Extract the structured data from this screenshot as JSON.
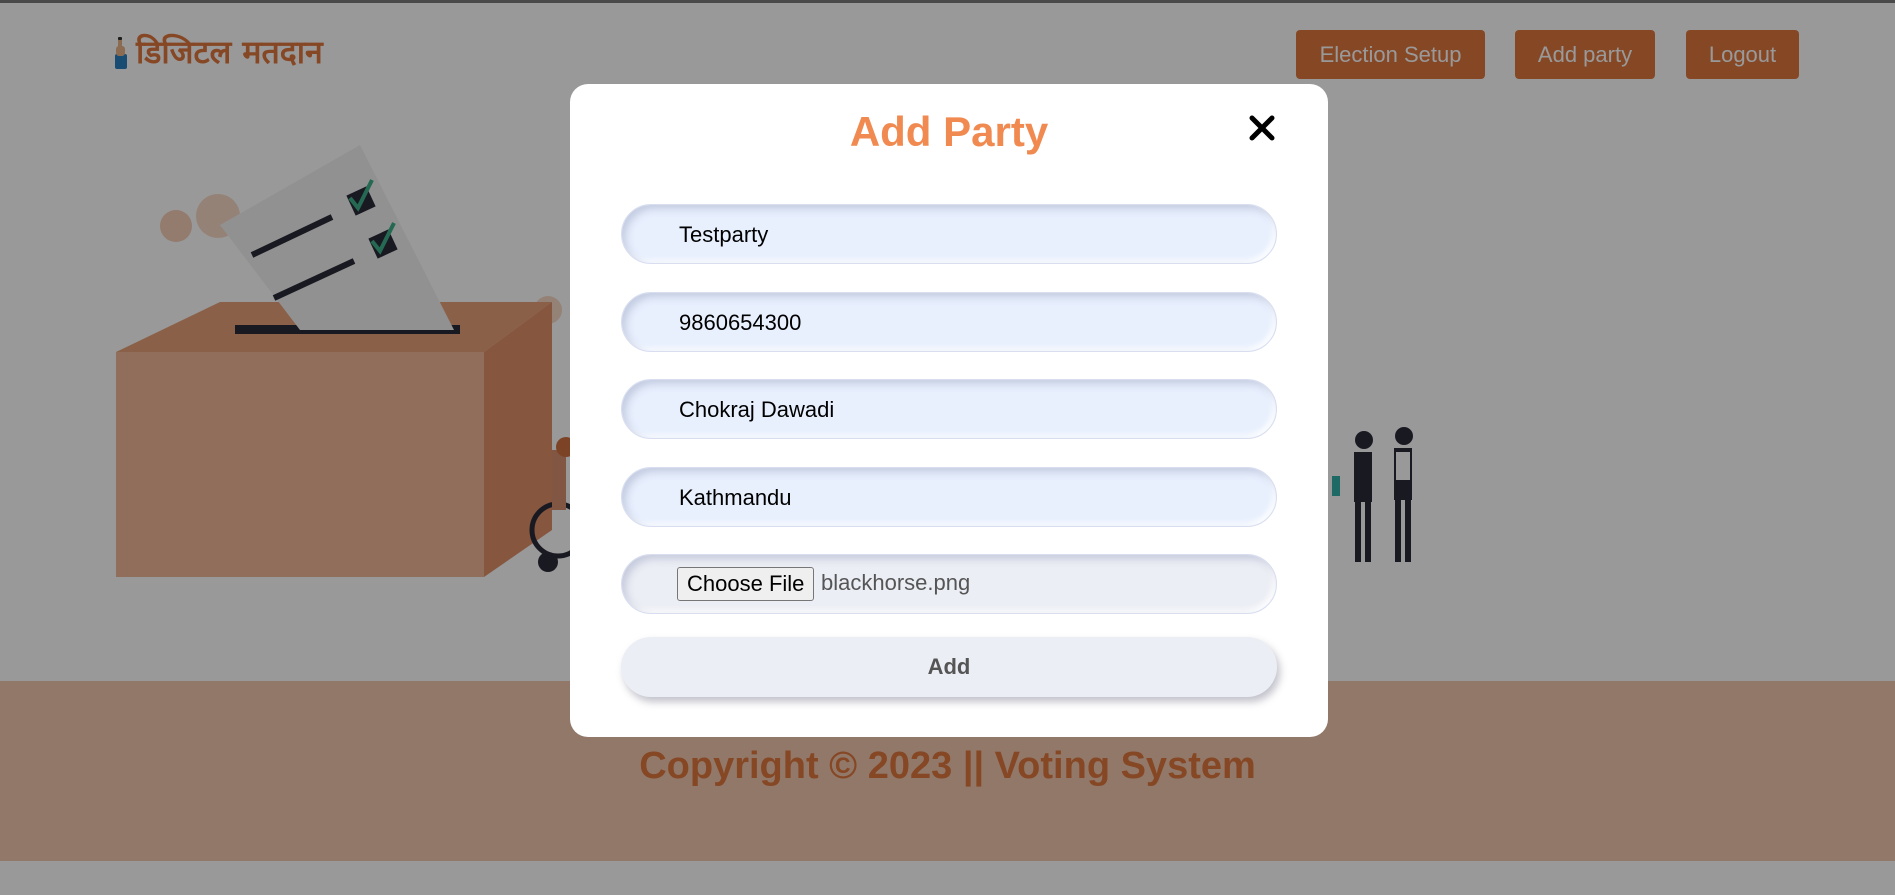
{
  "brand": {
    "logo_icon": "voting-finger-icon",
    "name": "डिजिटल मतदान"
  },
  "nav": {
    "election_setup": "Election Setup",
    "add_party": "Add party",
    "logout": "Logout"
  },
  "footer": {
    "copyright": "Copyright © 2023 || Voting System"
  },
  "modal": {
    "title": "Add Party",
    "close_icon": "close-icon",
    "fields": {
      "party_name": "Testparty",
      "phone": "9860654300",
      "leader": "Chokraj Dawadi",
      "address": "Kathmandu"
    },
    "file": {
      "button_label": "Choose File",
      "file_name": "blackhorse.png"
    },
    "submit_label": "Add"
  },
  "colors": {
    "accent": "#e0773f",
    "title": "#f08a50",
    "input_bg": "#e8f0fe",
    "footer_bg": "#f3c9b0"
  }
}
